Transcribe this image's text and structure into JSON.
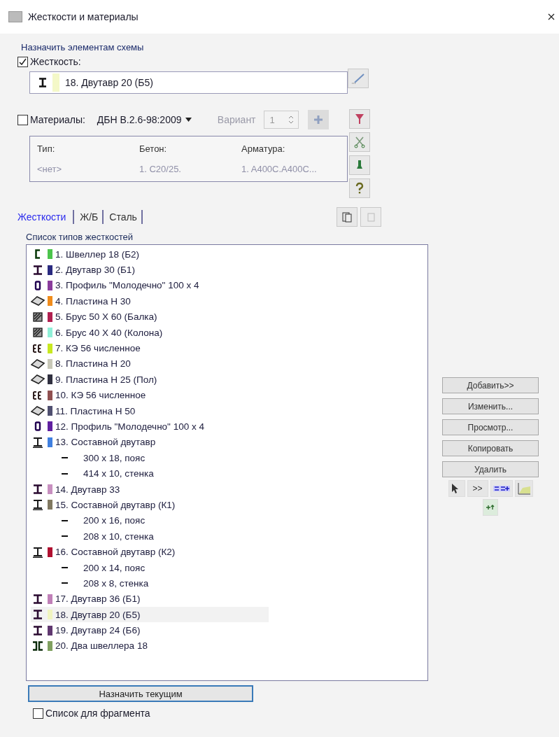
{
  "window": {
    "title": "Жесткости и материалы"
  },
  "assign": {
    "heading": "Назначить элементам схемы",
    "stiffness": {
      "label": "Жесткость:",
      "checked": true,
      "current": {
        "kind": "ibeam",
        "color": "#f4f8c8",
        "label": "18. Двутавр 20 (Б5)"
      }
    },
    "materials": {
      "label": "Материалы:",
      "checked": false,
      "norm": "ДБН В.2.6-98:2009",
      "variant_label": "Вариант",
      "variant": "1",
      "disabled": true
    },
    "materials_table": {
      "columns": [
        "Тип:",
        "Бетон:",
        "Арматура:"
      ],
      "values": [
        "<нет>",
        "1. C20/25.",
        "1. A400C.A400C..."
      ]
    }
  },
  "tabs": [
    {
      "label": "Жесткости",
      "selected": true
    },
    {
      "label": "Ж/Б",
      "selected": false
    },
    {
      "label": "Сталь",
      "selected": false
    }
  ],
  "list": {
    "title": "Список типов жесткостей",
    "items": [
      {
        "kind": "channel",
        "color": "#4cc44c",
        "label": "1. Швеллер 18 (Б2)",
        "selected": false
      },
      {
        "kind": "ibeam",
        "color": "#2a2a80",
        "label": "2. Двутавр 30 (Б1)",
        "selected": false
      },
      {
        "kind": "tube",
        "color": "#8a3c9c",
        "label": "3. Профиль \"Молодечно\" 100 х 4",
        "selected": false
      },
      {
        "kind": "plate",
        "color": "#f08c1c",
        "label": "4. Пластина  Н 30",
        "selected": false
      },
      {
        "kind": "bar",
        "color": "#b02050",
        "label": "5. Брус 50 Х 60 (Балка)",
        "selected": false
      },
      {
        "kind": "bar",
        "color": "#90f0d8",
        "label": "6. Брус 40 Х 40 (Колона)",
        "selected": false
      },
      {
        "kind": "fe",
        "color": "#c8e820",
        "label": "7. КЭ 56 численное",
        "selected": false
      },
      {
        "kind": "plate",
        "color": "#c8c8b8",
        "label": "8. Пластина  Н 20",
        "selected": false
      },
      {
        "kind": "plate",
        "color": "#303040",
        "label": "9. Пластина  Н 25 (Пол)",
        "selected": false
      },
      {
        "kind": "fe",
        "color": "#905050",
        "label": "10. КЭ 56 численное",
        "selected": false
      },
      {
        "kind": "plate",
        "color": "#505070",
        "label": "11. Пластина  Н 50",
        "selected": false
      },
      {
        "kind": "tube",
        "color": "#6020a0",
        "label": "12. Профиль \"Молодечно\" 100 х 4",
        "selected": false
      },
      {
        "kind": "composite",
        "color": "#4080e0",
        "label": "13. Составной двутавр",
        "selected": false,
        "children": [
          {
            "label": "300 х 18, пояс"
          },
          {
            "label": "414 х 10, стенка"
          }
        ]
      },
      {
        "kind": "ibeam",
        "color": "#c890c0",
        "label": "14. Двутавр 33",
        "selected": false
      },
      {
        "kind": "composite",
        "color": "#807860",
        "label": "15. Составной двутавр (К1)",
        "selected": false,
        "children": [
          {
            "label": "200 х 16, пояс"
          },
          {
            "label": "208 х 10, стенка"
          }
        ]
      },
      {
        "kind": "composite",
        "color": "#b01030",
        "label": "16. Составной двутавр (К2)",
        "selected": false,
        "children": [
          {
            "label": "200 х 14, пояс"
          },
          {
            "label": "208 х 8, стенка"
          }
        ]
      },
      {
        "kind": "ibeam",
        "color": "#c080b8",
        "label": "17. Двутавр 36 (Б1)",
        "selected": false
      },
      {
        "kind": "ibeam",
        "color": "#f0f4c0",
        "label": "18. Двутавр 20 (Б5)",
        "selected": true
      },
      {
        "kind": "ibeam",
        "color": "#603870",
        "label": "19. Двутавр 24 (Б6)",
        "selected": false
      },
      {
        "kind": "double-channel",
        "color": "#80a060",
        "label": "20. Два швеллера 18",
        "selected": false
      }
    ]
  },
  "side_buttons": [
    "Добавить>>",
    "Изменить...",
    "Просмотр...",
    "Копировать",
    "Удалить"
  ],
  "arrow_button": ">>",
  "assign_button": "Назначить текущим",
  "fragment": {
    "label": "Список для фрагмента",
    "checked": false
  }
}
